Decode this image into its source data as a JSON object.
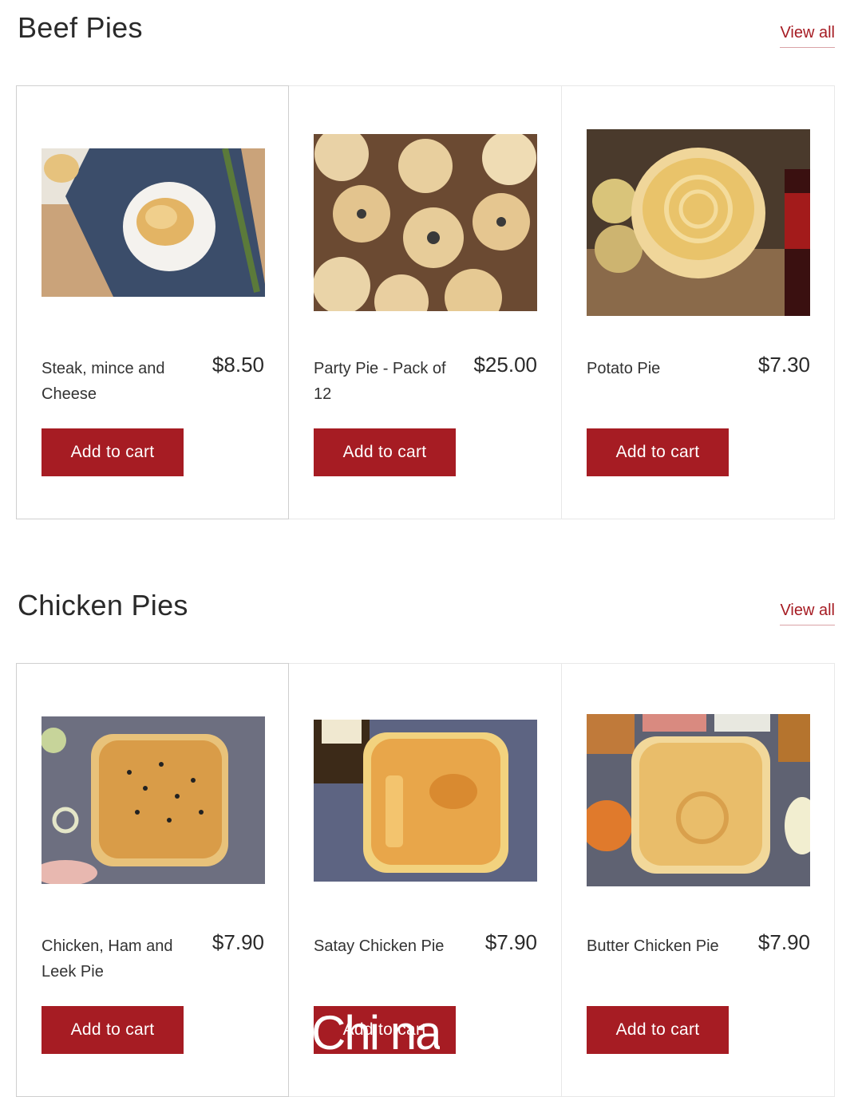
{
  "sections": [
    {
      "title": "Beef Pies",
      "view_all": "View all",
      "products": [
        {
          "name": "Steak, mince and Cheese",
          "price": "$8.50",
          "button": "Add to cart",
          "image": "steak-mince-cheese-pie-photo"
        },
        {
          "name": "Party Pie - Pack of 12",
          "price": "$25.00",
          "button": "Add to cart",
          "image": "party-pies-photo"
        },
        {
          "name": "Potato Pie",
          "price": "$7.30",
          "button": "Add to cart",
          "image": "potato-pie-photo"
        }
      ]
    },
    {
      "title": "Chicken Pies",
      "view_all": "View all",
      "products": [
        {
          "name": "Chicken, Ham and Leek Pie",
          "price": "$7.90",
          "button": "Add to cart",
          "image": "chicken-ham-leek-pie-photo"
        },
        {
          "name": "Satay Chicken Pie",
          "price": "$7.90",
          "button": "Add to cart",
          "image": "satay-chicken-pie-photo"
        },
        {
          "name": "Butter Chicken Pie",
          "price": "$7.90",
          "button": "Add to cart",
          "image": "butter-chicken-pie-photo"
        }
      ]
    }
  ],
  "overlay_text": "Chi na",
  "colors": {
    "accent": "#a61c23",
    "text": "#2a2a2a",
    "border": "#e8e8e8"
  }
}
